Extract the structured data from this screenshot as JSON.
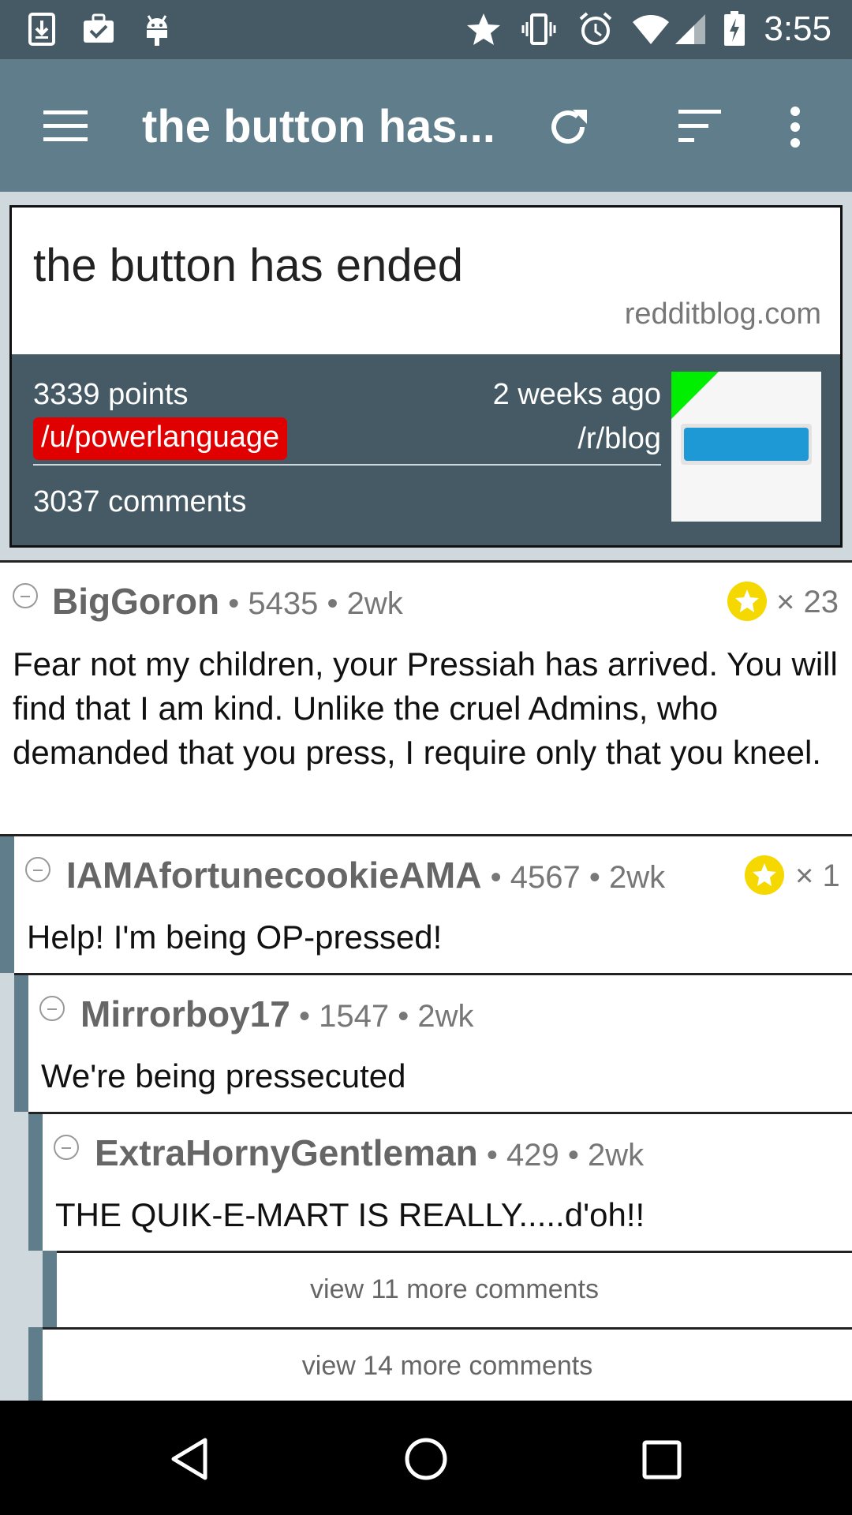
{
  "status_bar": {
    "time": "3:55",
    "icons": [
      "download-icon",
      "briefcase-check-icon",
      "android-icon",
      "star-icon",
      "vibrate-icon",
      "alarm-icon",
      "wifi-icon",
      "signal-icon",
      "battery-charging-icon"
    ]
  },
  "toolbar": {
    "title": "the button has...",
    "icons": [
      "menu-icon",
      "refresh-icon",
      "sort-icon",
      "more-vert-icon"
    ]
  },
  "post": {
    "title": "the button has ended",
    "domain": "redditblog.com",
    "points": "3339 points",
    "author": "/u/powerlanguage",
    "time": "2 weeks ago",
    "subreddit": "/r/blog",
    "comments": "3037 comments",
    "colors": {
      "header": "#455a64",
      "toolbar": "#607d8b",
      "author_badge": "#e00000",
      "thumb_green": "#00ee00",
      "thumb_bar": "#1f99d6"
    }
  },
  "comments": [
    {
      "author": "BigGoron",
      "score": "5435",
      "age": "2wk",
      "gilded": "× 23",
      "sep": "•",
      "body": "Fear not my children, your Pressiah has arrived. You will find that I am kind. Unlike the cruel Admins, who demanded that you press, I require only that you kneel."
    },
    {
      "author": "IAMAfortunecookieAMA",
      "score": "4567",
      "age": "2wk",
      "gilded": "× 1",
      "sep": "•",
      "body": "Help! I'm being OP-pressed!"
    },
    {
      "author": "Mirrorboy17",
      "score": "1547",
      "age": "2wk",
      "sep": "•",
      "body": "We're being pressecuted"
    },
    {
      "author": "ExtraHornyGentleman",
      "score": "429",
      "age": "2wk",
      "sep": "•",
      "body": "THE QUIK-E-MART IS REALLY.....d'oh!!"
    }
  ],
  "more": [
    {
      "label": "view 11 more comments"
    },
    {
      "label": "view 14 more comments"
    }
  ],
  "nav_bar": {
    "icons": [
      "back-icon",
      "home-icon",
      "recents-icon"
    ]
  }
}
